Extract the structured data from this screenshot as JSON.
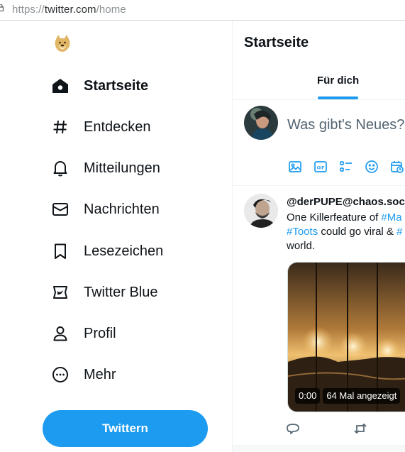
{
  "browser": {
    "url_scheme": "https://",
    "url_domain": "twitter.com",
    "url_path": "/home"
  },
  "sidebar": {
    "logo_icon": "doge-logo-icon",
    "items": [
      {
        "label": "Startseite",
        "icon": "home-icon",
        "active": true
      },
      {
        "label": "Entdecken",
        "icon": "hashtag-icon",
        "active": false
      },
      {
        "label": "Mitteilungen",
        "icon": "bell-icon",
        "active": false
      },
      {
        "label": "Nachrichten",
        "icon": "envelope-icon",
        "active": false
      },
      {
        "label": "Lesezeichen",
        "icon": "bookmark-icon",
        "active": false
      },
      {
        "label": "Twitter Blue",
        "icon": "twitter-blue-icon",
        "active": false
      },
      {
        "label": "Profil",
        "icon": "person-icon",
        "active": false
      },
      {
        "label": "Mehr",
        "icon": "more-circle-icon",
        "active": false
      }
    ],
    "tweet_button": "Twittern"
  },
  "main": {
    "title": "Startseite",
    "tab_active": "Für dich",
    "compose": {
      "placeholder": "Was gibt's Neues?",
      "tools": [
        "image-icon",
        "gif-icon",
        "poll-icon",
        "emoji-icon",
        "schedule-icon"
      ]
    },
    "post": {
      "author": "@derPUPE@chaos.soci",
      "text_1": "One Killerfeature of ",
      "tag_1": "#Ma",
      "tag_2": "#Toots",
      "text_2": " could go viral & ",
      "tag_3": "#",
      "text_3": "world.",
      "video_time": "0:00",
      "video_views": "64 Mal angezeigt"
    }
  },
  "colors": {
    "accent": "#1d9bf0",
    "text": "#0f1419",
    "muted": "#536471"
  }
}
